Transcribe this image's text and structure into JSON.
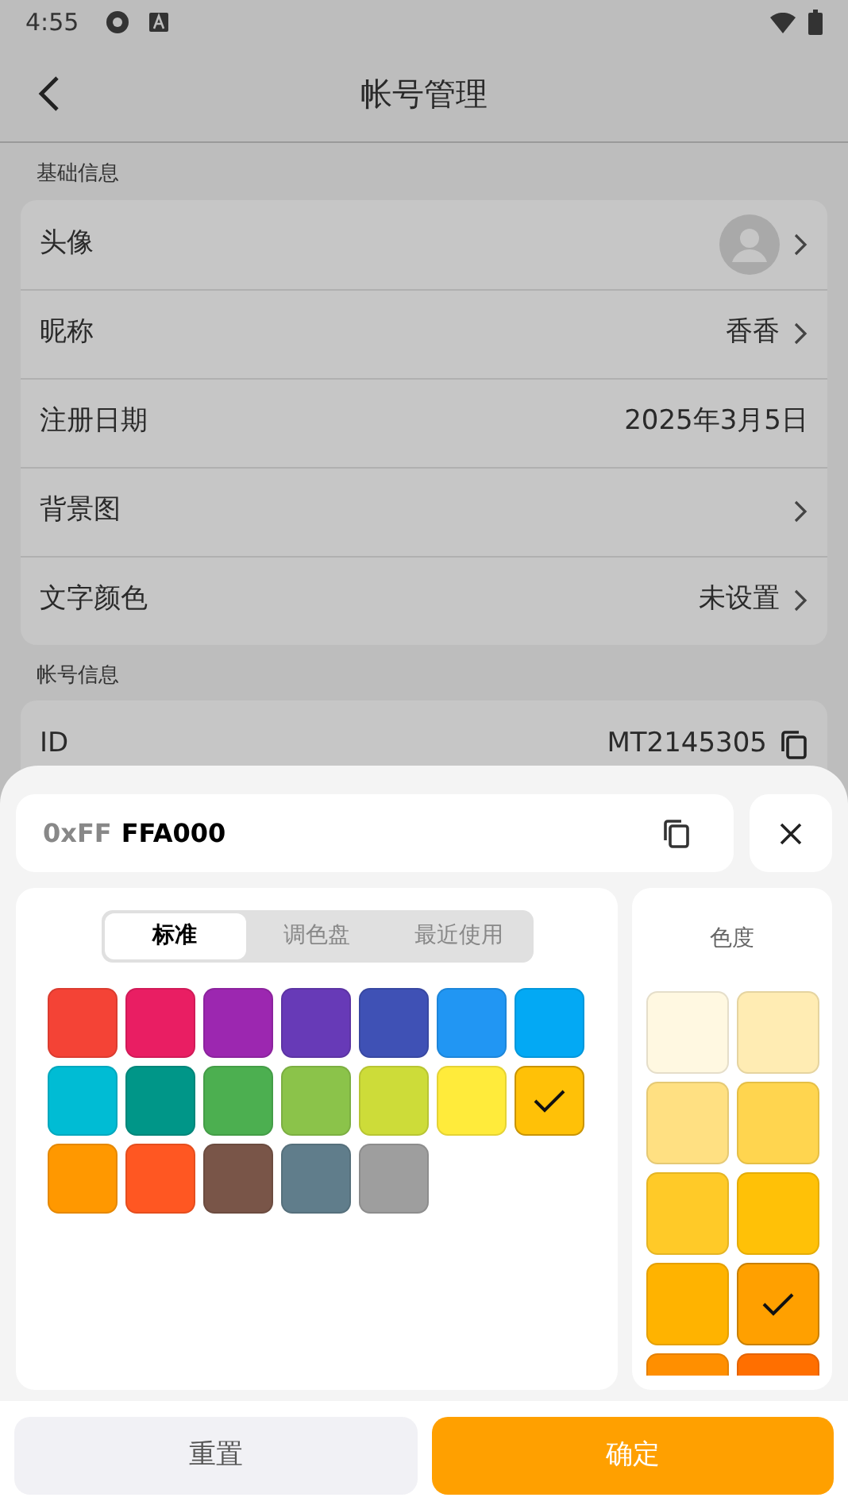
{
  "status_bar": {
    "time": "4:55"
  },
  "header": {
    "title": "帐号管理"
  },
  "sections": [
    {
      "label": "基础信息",
      "rows": [
        {
          "kind": "avatar",
          "label": "头像",
          "chevron": true
        },
        {
          "kind": "text",
          "label": "昵称",
          "value": "香香",
          "chevron": true
        },
        {
          "kind": "text",
          "label": "注册日期",
          "value": "2025年3月5日",
          "chevron": false
        },
        {
          "kind": "text",
          "label": "背景图",
          "chevron": true
        },
        {
          "kind": "text",
          "label": "文字颜色",
          "value": "未设置",
          "chevron": true
        }
      ]
    },
    {
      "label": "帐号信息",
      "rows": [
        {
          "kind": "copy",
          "label": "ID",
          "value": "MT2145305",
          "chevron": false
        }
      ]
    }
  ],
  "sheet": {
    "hex": {
      "prefix": "0xFF",
      "value": "FFA000"
    },
    "tabs": [
      {
        "label": "标准",
        "selected": true
      },
      {
        "label": "调色盘",
        "selected": false
      },
      {
        "label": "最近使用",
        "selected": false
      }
    ],
    "swatches": [
      {
        "color": "#f44336",
        "selected": false
      },
      {
        "color": "#e91e63",
        "selected": false
      },
      {
        "color": "#9c27b0",
        "selected": false
      },
      {
        "color": "#673ab7",
        "selected": false
      },
      {
        "color": "#3f51b5",
        "selected": false
      },
      {
        "color": "#2196f3",
        "selected": false
      },
      {
        "color": "#03a9f4",
        "selected": false
      },
      {
        "color": "#00bcd4",
        "selected": false
      },
      {
        "color": "#009688",
        "selected": false
      },
      {
        "color": "#4caf50",
        "selected": false
      },
      {
        "color": "#8bc34a",
        "selected": false
      },
      {
        "color": "#cddc39",
        "selected": false
      },
      {
        "color": "#ffeb3b",
        "selected": false
      },
      {
        "color": "#ffc107",
        "selected": true
      },
      {
        "color": "#ff9800",
        "selected": false
      },
      {
        "color": "#ff5722",
        "selected": false
      },
      {
        "color": "#795548",
        "selected": false
      },
      {
        "color": "#607d8b",
        "selected": false
      },
      {
        "color": "#9e9e9e",
        "selected": false
      }
    ],
    "shade_title": "色度",
    "shades": [
      {
        "color": "#fff8e1",
        "selected": false
      },
      {
        "color": "#ffecb3",
        "selected": false
      },
      {
        "color": "#ffe082",
        "selected": false
      },
      {
        "color": "#ffd54f",
        "selected": false
      },
      {
        "color": "#ffca28",
        "selected": false
      },
      {
        "color": "#ffc107",
        "selected": false
      },
      {
        "color": "#ffb300",
        "selected": false
      },
      {
        "color": "#ffa000",
        "selected": true
      },
      {
        "color": "#ff8f00",
        "selected": false
      },
      {
        "color": "#ff6f00",
        "selected": false
      }
    ],
    "buttons": [
      {
        "kind": "secondary",
        "label": "重置"
      },
      {
        "kind": "primary",
        "label": "确定"
      }
    ]
  }
}
